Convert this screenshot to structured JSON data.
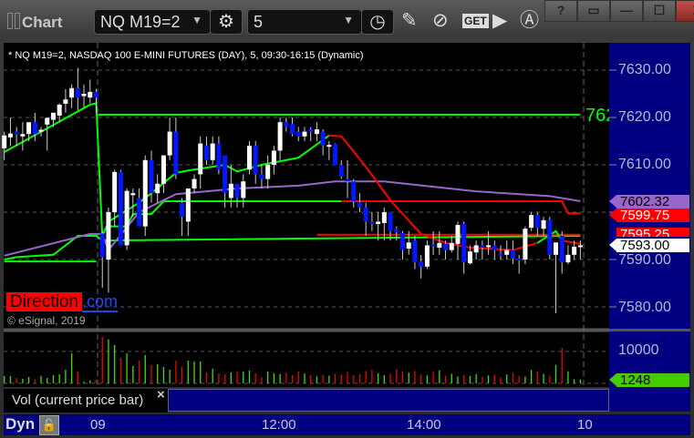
{
  "window": {
    "title": "Chart",
    "buttons": [
      "?",
      "▭",
      "—",
      "☐",
      "X"
    ]
  },
  "toolbar": {
    "symbol": "NQ M19=2",
    "interval": "5",
    "get_label": "GET"
  },
  "chart_header": "* NQ M19=2, NASDAQ 100 E-MINI FUTURES (DAY), 5, 09:30-16:15 (Dynamic)",
  "logo": {
    "text1": "Direction",
    "text2": ".com"
  },
  "copyright": "© eSignal, 2019",
  "price_axis": {
    "labels": [
      "7630.00",
      "7620.00",
      "7610.00",
      "7600.00",
      "7590.00",
      "7580.00"
    ],
    "tags": [
      {
        "text": "7602.32",
        "bg": "#9966cc",
        "fg": "#000000"
      },
      {
        "text": "7599.75",
        "bg": "#ff0000",
        "fg": "#ffffff"
      },
      {
        "text": "7595.25",
        "bg": "#ff0000",
        "fg": "#ffffff"
      },
      {
        "text": "7593.00",
        "bg": "#ffffff",
        "fg": "#000000"
      }
    ],
    "level_label": "762"
  },
  "volume_axis": {
    "label": "10000",
    "tag": "1248",
    "tag_color": "#44cc00"
  },
  "volume_panel_label": "Vol (current price bar)",
  "close_icon": "×",
  "time_axis": {
    "labels": [
      "09",
      "12:00",
      "14:00",
      "10"
    ],
    "mode": "Dyn"
  },
  "colors": {
    "up": "#ffffff",
    "down": "#0018ff",
    "vol_up": "#44dd00",
    "vol_down": "#ee0000",
    "axis_bg": "#000080"
  },
  "chart_data": {
    "type": "candlestick",
    "ylim": [
      7576,
      7636
    ],
    "y_ticks": [
      7580,
      7590,
      7600,
      7610,
      7620,
      7630
    ],
    "x_ticks": [
      "09",
      "12:00",
      "14:00",
      "10"
    ],
    "candles_ohlc": [
      [
        7613.5,
        7617,
        7611,
        7616.2
      ],
      [
        7615.8,
        7620,
        7614,
        7616.6
      ],
      [
        7617,
        7618,
        7614,
        7616.4
      ],
      [
        7616,
        7619,
        7613,
        7616.5
      ],
      [
        7616.5,
        7618,
        7615,
        7619
      ],
      [
        7619,
        7621,
        7615,
        7616.5
      ],
      [
        7617,
        7618,
        7616,
        7617.4
      ],
      [
        7618.5,
        7620,
        7613,
        7619.9
      ],
      [
        7619.5,
        7621,
        7618,
        7621
      ],
      [
        7620.4,
        7623,
        7619,
        7622.7
      ],
      [
        7622.9,
        7626,
        7621,
        7623.8
      ],
      [
        7624.2,
        7627,
        7622,
        7626.2
      ],
      [
        7626.2,
        7630.5,
        7621.5,
        7624.2
      ],
      [
        7624.5,
        7627,
        7622,
        7625
      ],
      [
        7624.2,
        7628,
        7623,
        7625.4
      ],
      [
        7625.4,
        7626,
        7621,
        7624.2
      ],
      [
        7595.5,
        7596,
        7584,
        7590.5
      ],
      [
        7590,
        7601,
        7583,
        7600
      ],
      [
        7600,
        7609,
        7597,
        7608.5
      ],
      [
        7608.5,
        7609,
        7595,
        7593
      ],
      [
        7593,
        7605,
        7592,
        7604.5
      ],
      [
        7603.6,
        7605,
        7599,
        7604
      ],
      [
        7603,
        7605,
        7600,
        7597
      ],
      [
        7597,
        7612,
        7595,
        7611
      ],
      [
        7611,
        7613,
        7602,
        7604
      ],
      [
        7604,
        7608,
        7602,
        7606
      ],
      [
        7606,
        7612,
        7604,
        7612
      ],
      [
        7612,
        7620,
        7611,
        7617
      ],
      [
        7617,
        7620,
        7607,
        7608
      ],
      [
        7602,
        7603,
        7595,
        7599
      ],
      [
        7598,
        7605,
        7595,
        7605
      ],
      [
        7605,
        7608,
        7604,
        7607
      ],
      [
        7608,
        7616,
        7605,
        7614.5
      ],
      [
        7614,
        7616,
        7610,
        7611
      ],
      [
        7611,
        7616,
        7610,
        7614.5
      ],
      [
        7614.5,
        7616,
        7608,
        7609
      ],
      [
        7612,
        7612,
        7601,
        7604
      ],
      [
        7603,
        7610,
        7601,
        7606
      ],
      [
        7606,
        7606,
        7601,
        7603
      ],
      [
        7603,
        7608,
        7601,
        7606.5
      ],
      [
        7609,
        7615,
        7608,
        7614
      ],
      [
        7614,
        7615,
        7606,
        7608
      ],
      [
        7608,
        7610,
        7605,
        7607
      ],
      [
        7607,
        7612,
        7605,
        7610
      ],
      [
        7610,
        7614,
        7608,
        7613
      ],
      [
        7613,
        7620,
        7611,
        7619
      ],
      [
        7619,
        7620,
        7617,
        7618
      ],
      [
        7618.6,
        7620,
        7616,
        7616.5
      ],
      [
        7617,
        7618,
        7615,
        7616
      ],
      [
        7616,
        7618,
        7615,
        7617
      ],
      [
        7617.5,
        7618,
        7615,
        7617
      ],
      [
        7616.5,
        7619,
        7615,
        7617.5
      ],
      [
        7617,
        7617.5,
        7612,
        7614
      ],
      [
        7614,
        7615,
        7611,
        7614.2
      ],
      [
        7614.4,
        7614.5,
        7610,
        7610
      ],
      [
        7610,
        7611,
        7607,
        7607.5
      ],
      [
        7607,
        7611,
        7603,
        7606.5
      ],
      [
        7606.5,
        7607,
        7601,
        7602.3
      ],
      [
        7602,
        7604,
        7600,
        7601
      ],
      [
        7601,
        7602,
        7595,
        7598
      ],
      [
        7598,
        7600,
        7596,
        7597.5
      ],
      [
        7597.5,
        7600,
        7594,
        7598
      ],
      [
        7597.7,
        7601,
        7594,
        7600
      ],
      [
        7600,
        7600,
        7594,
        7596
      ],
      [
        7596.5,
        7597,
        7594,
        7595.8
      ],
      [
        7595.6,
        7596,
        7590,
        7592
      ],
      [
        7592.3,
        7596,
        7591,
        7593.6
      ],
      [
        7594,
        7595,
        7588,
        7589.4
      ],
      [
        7589.6,
        7591,
        7586,
        7588.5
      ],
      [
        7588.5,
        7594,
        7588,
        7593
      ],
      [
        7593.2,
        7596,
        7591,
        7593
      ],
      [
        7592.5,
        7596,
        7591,
        7593.5
      ],
      [
        7593.3,
        7594,
        7590,
        7592
      ],
      [
        7592,
        7595,
        7591.5,
        7593.5
      ],
      [
        7593.3,
        7598,
        7590,
        7597.3
      ],
      [
        7597.5,
        7598,
        7587,
        7589.4
      ],
      [
        7589.2,
        7593,
        7589,
        7591.7
      ],
      [
        7591.5,
        7594,
        7590,
        7593
      ],
      [
        7593,
        7594,
        7590,
        7592.5
      ],
      [
        7592.7,
        7596,
        7591,
        7593
      ],
      [
        7593,
        7594,
        7590,
        7592
      ],
      [
        7591.2,
        7593,
        7590,
        7591
      ],
      [
        7591,
        7594,
        7590,
        7592
      ],
      [
        7592,
        7594,
        7589,
        7590.2
      ],
      [
        7590.2,
        7591,
        7587,
        7590
      ],
      [
        7590,
        7597,
        7589,
        7596.5
      ],
      [
        7596.7,
        7600,
        7596,
        7599.4
      ],
      [
        7599.4,
        7600,
        7595,
        7596.7
      ],
      [
        7596.5,
        7599,
        7595,
        7598.3
      ],
      [
        7598.3,
        7599,
        7590,
        7591
      ],
      [
        7591,
        7593,
        7578.7,
        7593.6
      ],
      [
        7595,
        7596,
        7587,
        7589.4
      ],
      [
        7589.4,
        7593,
        7589,
        7591
      ],
      [
        7591,
        7594,
        7590,
        7592.7
      ],
      [
        7592.7,
        7594,
        7590,
        7593
      ]
    ],
    "volume": [
      2290,
      2290,
      1710,
      1430,
      2000,
      1240,
      2290,
      1710,
      2570,
      2860,
      4290,
      9430,
      3710,
      570,
      950,
      1200,
      14570,
      13800,
      12000,
      8000,
      9430,
      5430,
      7140,
      8860,
      5710,
      6000,
      5140,
      4290,
      7140,
      5140,
      7140,
      6860,
      6860,
      3430,
      4570,
      3140,
      2860,
      3430,
      3710,
      3710,
      4000,
      3140,
      2000,
      3710,
      3140,
      2900,
      3300,
      2600,
      3800,
      3100,
      2500,
      2200,
      2700,
      2400,
      3000,
      2800,
      3600,
      2500,
      2900,
      3900,
      4200,
      3200,
      2600,
      3000,
      4500,
      3700,
      3400,
      3900,
      2800,
      2500,
      3600,
      4100,
      2400,
      3000,
      2200,
      2600,
      2300,
      2900,
      2000,
      2500,
      2700,
      1900,
      2800,
      3300,
      2400,
      2100,
      4200,
      3800,
      3000,
      2400,
      5700,
      11100,
      3800,
      1300,
      1248
    ],
    "volume_ylim": [
      0,
      16000
    ],
    "lines": [
      {
        "color": "#00ff00",
        "points": [
          [
            15.3,
            7620.6
          ],
          [
            94,
            7620.6
          ]
        ]
      },
      {
        "color": "#00ff00",
        "points": [
          [
            0,
            7589.6
          ],
          [
            15,
            7589.6
          ]
        ]
      },
      {
        "color": "#00ff00",
        "points": [
          [
            0,
            7590
          ],
          [
            2,
            7590.5
          ],
          [
            8,
            7591
          ],
          [
            10,
            7593
          ],
          [
            12,
            7595
          ],
          [
            15,
            7595
          ],
          [
            16,
            7594
          ],
          [
            94,
            7595
          ]
        ]
      },
      {
        "color": "#ff0000",
        "points": [
          [
            51,
            7595.25
          ],
          [
            94,
            7595.25
          ]
        ]
      },
      {
        "color": "#00ff00",
        "points": [
          [
            17,
            7597
          ],
          [
            20,
            7597
          ],
          [
            21,
            7599.6
          ],
          [
            24,
            7599.6
          ],
          [
            26,
            7602.3
          ],
          [
            40,
            7602.3
          ],
          [
            55,
            7602.3
          ]
        ]
      },
      {
        "color": "#ff0000",
        "points": [
          [
            55,
            7602.3
          ],
          [
            91,
            7602.3
          ],
          [
            92,
            7599.75
          ],
          [
            94,
            7599.75
          ]
        ]
      },
      {
        "color": "#9966cc",
        "points": [
          [
            0,
            7590.8
          ],
          [
            14,
            7595.4
          ],
          [
            16,
            7595.4
          ],
          [
            17,
            7592
          ],
          [
            22,
            7600
          ],
          [
            28,
            7603.8
          ],
          [
            38,
            7605
          ],
          [
            48,
            7605.6
          ],
          [
            54,
            7606.5
          ],
          [
            62,
            7606.5
          ],
          [
            77,
            7604.4
          ],
          [
            89,
            7603.4
          ],
          [
            94,
            7602.32
          ]
        ]
      },
      {
        "color": "#00ff00",
        "points": [
          [
            0,
            7612.7
          ],
          [
            14,
            7622.7
          ],
          [
            15,
            7623
          ],
          [
            16,
            7594.8
          ],
          [
            17,
            7598
          ],
          [
            22,
            7602
          ],
          [
            24,
            7604
          ],
          [
            28,
            7608.3
          ],
          [
            30,
            7608.8
          ],
          [
            36,
            7610
          ],
          [
            38,
            7608.6
          ],
          [
            42,
            7610
          ],
          [
            48,
            7611.5
          ],
          [
            53,
            7616.2
          ]
        ]
      },
      {
        "color": "#ff0000",
        "points": [
          [
            53,
            7616.2
          ],
          [
            55,
            7616
          ],
          [
            59,
            7609.6
          ],
          [
            63,
            7602.5
          ],
          [
            68,
            7595.4
          ],
          [
            72,
            7593.5
          ],
          [
            76,
            7592.5
          ],
          [
            83,
            7592
          ],
          [
            87,
            7593.5
          ]
        ]
      },
      {
        "color": "#00ff00",
        "points": [
          [
            87,
            7593.5
          ],
          [
            90,
            7596
          ],
          [
            91,
            7594
          ]
        ]
      },
      {
        "color": "#ff0000",
        "points": [
          [
            91,
            7594
          ],
          [
            94,
            7593.3
          ]
        ]
      }
    ]
  }
}
